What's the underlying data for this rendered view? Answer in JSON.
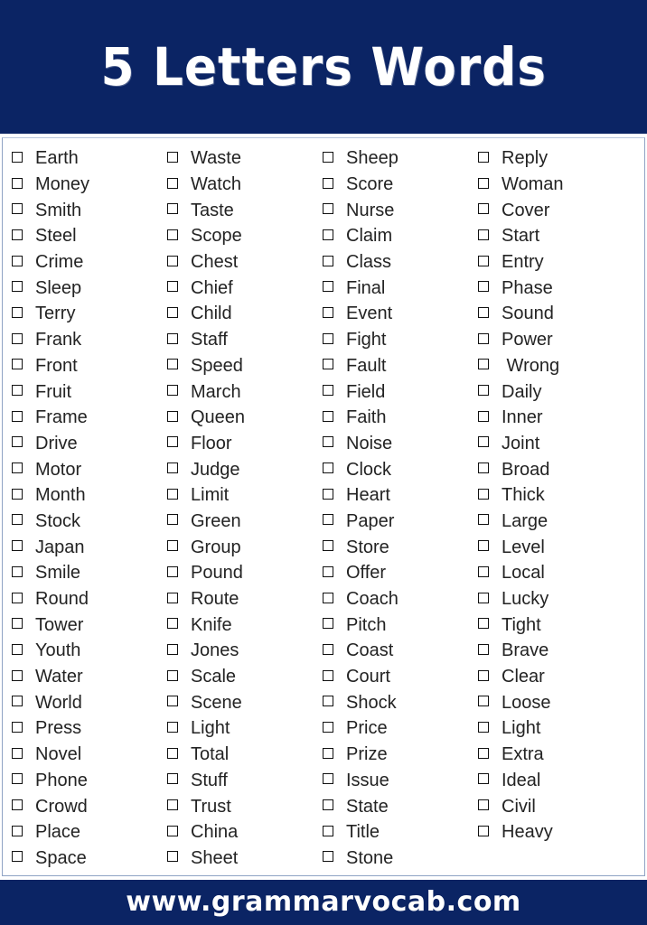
{
  "header": {
    "title": "5  Letters Words",
    "background_color": "#0b2464",
    "text_color": "#ffffff"
  },
  "list": {
    "checkbox_icon": "checkbox-unchecked-icon",
    "text_color": "#232323",
    "columns": [
      {
        "name": "column-1",
        "words": [
          "Earth",
          "Money",
          "Smith",
          "Steel",
          "Crime",
          "Sleep",
          "Terry",
          "Frank",
          "Front",
          "Fruit",
          "Frame",
          "Drive",
          "Motor",
          "Month",
          "Stock",
          "Japan",
          "Smile",
          "Round",
          "Tower",
          "Youth",
          "Water",
          "World",
          "Press",
          "Novel",
          "Phone",
          "Crowd",
          "Place",
          "Space"
        ]
      },
      {
        "name": "column-2",
        "words": [
          "Waste",
          "Watch",
          "Taste",
          "Scope",
          "Chest",
          "Chief",
          "Child",
          "Staff",
          "Speed",
          "March",
          "Queen",
          "Floor",
          "Judge",
          "Limit",
          "Green",
          "Group",
          "Pound",
          "Route",
          "Knife",
          "Jones",
          "Scale",
          "Scene",
          "Light",
          "Total",
          "Stuff",
          "Trust",
          "China",
          "Sheet"
        ]
      },
      {
        "name": "column-3",
        "words": [
          "Sheep",
          "Score",
          "Nurse",
          "Claim",
          "Class",
          "Final",
          "Event",
          "Fight",
          "Fault",
          "Field",
          "Faith",
          "Noise",
          "Clock",
          "Heart",
          "Paper",
          "Store",
          "Offer",
          "Coach",
          "Pitch",
          "Coast",
          "Court",
          "Shock",
          "Price",
          "Prize",
          "Issue",
          "State",
          "Title",
          "Stone"
        ]
      },
      {
        "name": "column-4",
        "words": [
          "Reply",
          "Woman",
          "Cover",
          "Start",
          "Entry",
          "Phase",
          "Sound",
          "Power",
          " Wrong",
          "Daily",
          "Inner",
          "Joint",
          "Broad",
          "Thick",
          "Large",
          "Level",
          "Local",
          "Lucky",
          "Tight",
          "Brave",
          "Clear",
          "Loose",
          "Light",
          "Extra",
          "Ideal",
          "Civil",
          "Heavy"
        ]
      }
    ]
  },
  "footer": {
    "website": "www.grammarvocab.com",
    "background_color": "#0b2464",
    "text_color": "#ffffff"
  }
}
